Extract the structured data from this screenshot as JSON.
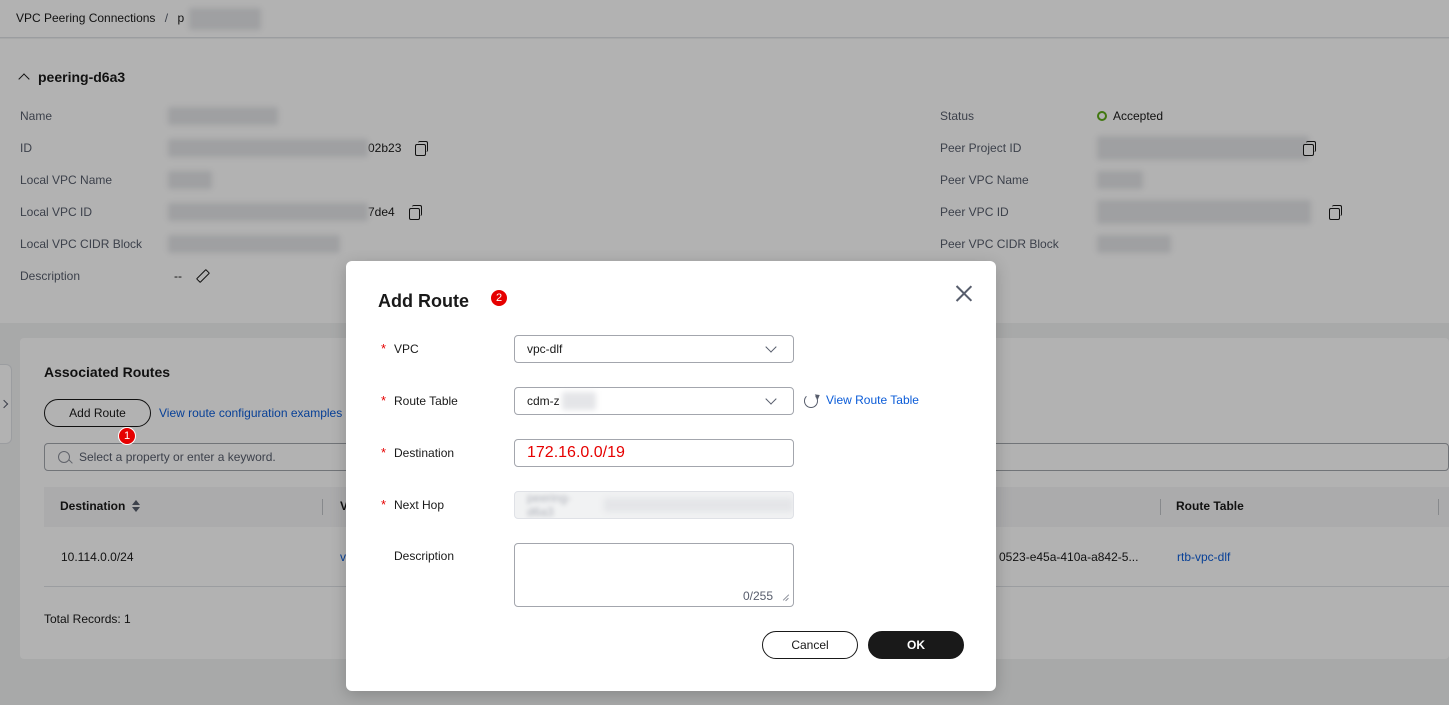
{
  "breadcrumb": {
    "parent": "VPC Peering Connections",
    "separator": "/",
    "current": "p"
  },
  "peering": {
    "name": "peering-d6a3",
    "left_fields": [
      {
        "label": "Name",
        "value": ""
      },
      {
        "label": "ID",
        "value": "02b23"
      },
      {
        "label": "Local VPC Name",
        "value": ""
      },
      {
        "label": "Local VPC ID",
        "value": "7de4"
      },
      {
        "label": "Local VPC CIDR Block",
        "value": ""
      },
      {
        "label": "Description",
        "value": "--"
      }
    ],
    "right_fields": [
      {
        "label": "Status",
        "value": "Accepted"
      },
      {
        "label": "Peer Project ID",
        "value": ""
      },
      {
        "label": "Peer VPC Name",
        "value": ""
      },
      {
        "label": "Peer VPC ID",
        "value": ""
      },
      {
        "label": "Peer VPC CIDR Block",
        "value": ""
      }
    ]
  },
  "routes": {
    "title": "Associated Routes",
    "add_button": "Add Route",
    "examples_link": "View route configuration examples",
    "search_placeholder": "Select a property or enter a keyword.",
    "columns": [
      "Destination",
      "V",
      "Route Table"
    ],
    "rows": [
      {
        "destination": "10.114.0.0/24",
        "vpc": "v",
        "next_hop": "0523-e45a-410a-a842-5...",
        "route_table": "rtb-vpc-dlf"
      }
    ],
    "total": "Total Records: 1"
  },
  "markers": {
    "add_route": "1",
    "dialog": "2"
  },
  "dialog": {
    "title": "Add Route",
    "fields": {
      "vpc": {
        "label": "VPC",
        "value": "vpc-dlf"
      },
      "route_table": {
        "label": "Route Table",
        "value": "cdm-z",
        "link": "View Route Table"
      },
      "destination": {
        "label": "Destination",
        "value": "172.16.0.0/19"
      },
      "next_hop": {
        "label": "Next Hop",
        "value": "peering-d6a3"
      },
      "description": {
        "label": "Description",
        "counter": "0/255"
      }
    },
    "cancel": "Cancel",
    "ok": "OK"
  },
  "colors": {
    "accent_link": "#0b5cd8",
    "required": "#e60000",
    "marker": "#e60000",
    "status_ok": "#5dab17",
    "primary_button": "#191919"
  }
}
